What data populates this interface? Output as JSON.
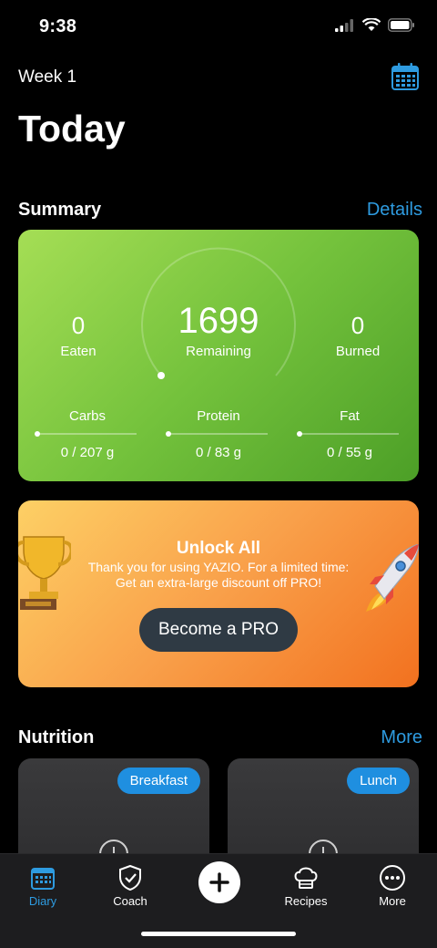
{
  "status": {
    "time": "9:38"
  },
  "header": {
    "week": "Week 1",
    "title": "Today"
  },
  "summary": {
    "section_title": "Summary",
    "details_link": "Details",
    "eaten_value": "0",
    "eaten_label": "Eaten",
    "remaining_value": "1699",
    "remaining_label": "Remaining",
    "burned_value": "0",
    "burned_label": "Burned",
    "macros": [
      {
        "label": "Carbs",
        "value": "0 / 207 g"
      },
      {
        "label": "Protein",
        "value": "0 / 83 g"
      },
      {
        "label": "Fat",
        "value": "0 / 55 g"
      }
    ]
  },
  "promo": {
    "title": "Unlock All",
    "text": "Thank you for using YAZIO. For a limited time: Get an extra-large discount off PRO!",
    "button": "Become a PRO"
  },
  "nutrition": {
    "section_title": "Nutrition",
    "more_link": "More",
    "meals": [
      {
        "label": "Breakfast"
      },
      {
        "label": "Lunch"
      }
    ]
  },
  "tabs": [
    {
      "label": "Diary",
      "icon": "calendar-icon",
      "active": true
    },
    {
      "label": "Coach",
      "icon": "shield-check-icon"
    },
    {
      "label": "Recipes",
      "icon": "chef-hat-icon"
    },
    {
      "label": "More",
      "icon": "more-dots-icon"
    }
  ],
  "colors": {
    "accent": "#2e9be0",
    "summary_green": "#74c23c",
    "promo_orange": "#f9a04a",
    "pro_button": "#2f3a44"
  }
}
